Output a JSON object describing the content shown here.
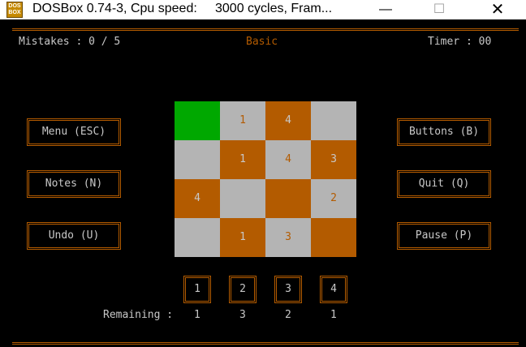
{
  "window": {
    "title": "DOSBox 0.74-3, Cpu speed:     3000 cycles, Fram...",
    "icon": "dosbox-icon",
    "icon_text": "DOS BOX",
    "minimize": "—",
    "maximize": "☐",
    "close": "✕"
  },
  "hud": {
    "mistakes": "Mistakes : 0 / 5",
    "mode": "Basic",
    "timer": "Timer : 00"
  },
  "buttons": {
    "menu": "Menu (ESC)",
    "notes": "Notes (N)",
    "undo": "Undo (U)",
    "buttons": "Buttons (B)",
    "quit": "Quit (Q)",
    "pause": "Pause (P)"
  },
  "colors": {
    "orange": "#b35b00",
    "gray": "#b4b4b4",
    "green": "#00a800",
    "text": "#c8c8c8"
  },
  "board": {
    "rows": [
      [
        {
          "v": "",
          "c": "green"
        },
        {
          "v": "1",
          "c": "gray"
        },
        {
          "v": "4",
          "c": "orange"
        },
        {
          "v": "",
          "c": "gray"
        }
      ],
      [
        {
          "v": "",
          "c": "gray"
        },
        {
          "v": "1",
          "c": "orange"
        },
        {
          "v": "4",
          "c": "gray"
        },
        {
          "v": "3",
          "c": "orange"
        }
      ],
      [
        {
          "v": "4",
          "c": "orange"
        },
        {
          "v": "",
          "c": "gray"
        },
        {
          "v": "",
          "c": "orange"
        },
        {
          "v": "2",
          "c": "gray"
        }
      ],
      [
        {
          "v": "",
          "c": "gray"
        },
        {
          "v": "1",
          "c": "orange"
        },
        {
          "v": "3",
          "c": "gray"
        },
        {
          "v": "",
          "c": "orange"
        }
      ]
    ]
  },
  "number_pad": {
    "label": "Remaining :",
    "numbers": [
      "1",
      "2",
      "3",
      "4"
    ],
    "remaining": [
      "1",
      "3",
      "2",
      "1"
    ]
  }
}
